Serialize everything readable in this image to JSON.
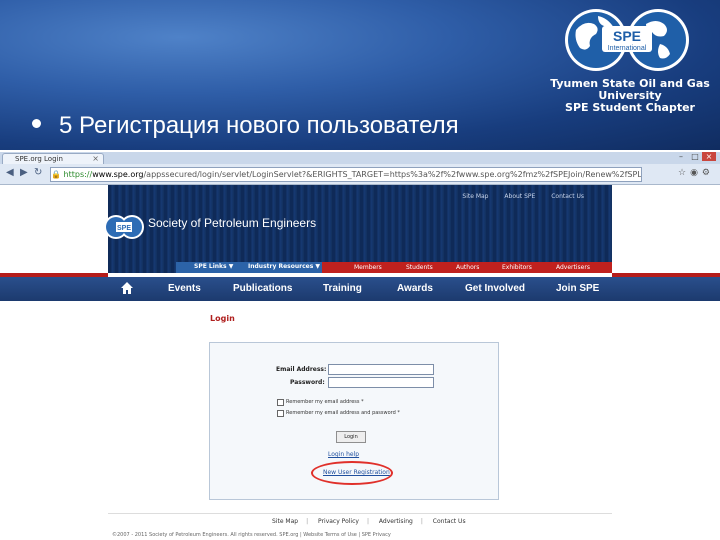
{
  "slide": {
    "bullet_text": "5 Регистрация нового пользователя",
    "logo": {
      "badge_line1": "SPE",
      "badge_line2": "International",
      "caption_line1": "Tyumen State Oil and Gas University",
      "caption_line2": "SPE Student Chapter"
    }
  },
  "browser": {
    "tab_title": "SPE.org Login",
    "url_scheme": "https://",
    "url_host": "www.spe.org",
    "url_rest": "/appssecured/login/servlet/LoginServlet?&ERIGHTS_TARGET=https%3a%2f%2fwww.spe.org%2fmz%2fSPEJoin/Renew%2fSPLM0RProce"
  },
  "site": {
    "org_name": "Society of Petroleum Engineers",
    "header_links": [
      "Site Map",
      "About SPE",
      "Contact Us"
    ],
    "ribbon_left": [
      "SPE Links ▼",
      "Industry Resources ▼"
    ],
    "ribbon_right": [
      "Members",
      "Students",
      "Authors",
      "Exhibitors",
      "Advertisers"
    ],
    "main_nav": [
      "Events",
      "Publications",
      "Training",
      "Awards",
      "Get Involved",
      "Join SPE"
    ]
  },
  "login": {
    "title": "Login",
    "email_label": "Email Address:",
    "password_label": "Password:",
    "remember_email": "Remember my email address *",
    "remember_both": "Remember my email address and password *",
    "submit_label": "Login",
    "help_link": "Login help",
    "new_user_link": "New User Registration"
  },
  "footer": {
    "links": [
      "Site Map",
      "Privacy Policy",
      "Advertising",
      "Contact Us"
    ],
    "copyright": "©2007 - 2011 Society of Petroleum Engineers. All rights reserved.      SPE.org | Website Terms of Use | SPE Privacy"
  },
  "colors": {
    "slide_blue": "#2f5ea8",
    "header_navy": "#0f2a58",
    "nav_blue": "#2a4f8c",
    "ribbon_red": "#c0211e",
    "highlight_red": "#e0302a"
  }
}
